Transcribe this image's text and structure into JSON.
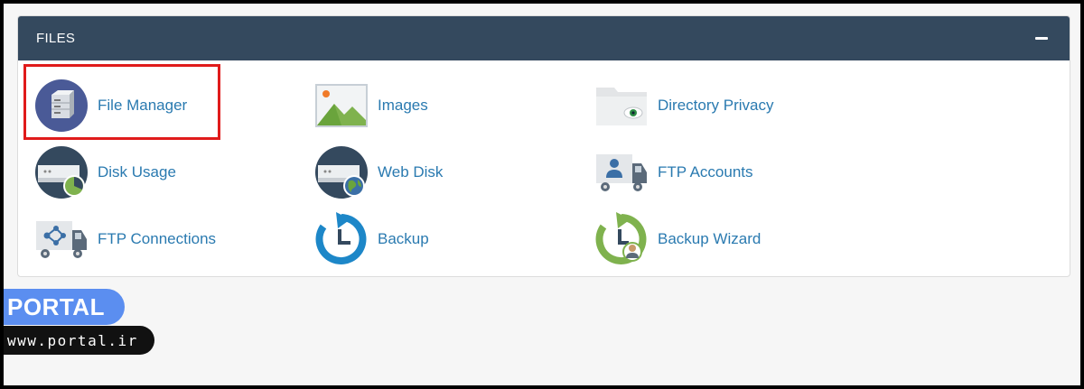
{
  "panel": {
    "title": "FILES",
    "collapse_icon": "minus-icon"
  },
  "items": [
    {
      "label": "File Manager",
      "icon": "file-manager-icon",
      "highlighted": true
    },
    {
      "label": "Images",
      "icon": "images-icon"
    },
    {
      "label": "Directory Privacy",
      "icon": "directory-privacy-icon"
    },
    {
      "label": "Disk Usage",
      "icon": "disk-usage-icon"
    },
    {
      "label": "Web Disk",
      "icon": "web-disk-icon"
    },
    {
      "label": "FTP Accounts",
      "icon": "ftp-accounts-icon"
    },
    {
      "label": "FTP Connections",
      "icon": "ftp-connections-icon"
    },
    {
      "label": "Backup",
      "icon": "backup-icon"
    },
    {
      "label": "Backup Wizard",
      "icon": "backup-wizard-icon"
    }
  ],
  "watermark": {
    "brand": "PORTAL",
    "site": "www.portal.ir"
  },
  "colors": {
    "header_bg": "#34495e",
    "link": "#2a7ab0",
    "highlight": "#e01b1b",
    "brand_bg": "#5b8ef0"
  }
}
